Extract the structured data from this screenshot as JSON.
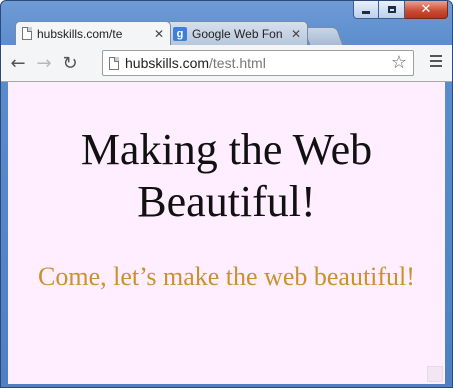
{
  "window": {
    "controls": {
      "minimize": "minimize-icon",
      "maximize": "maximize-icon",
      "close": "close-icon"
    }
  },
  "tabs": [
    {
      "label": "hubskills.com/te",
      "active": true,
      "icon": "page-icon"
    },
    {
      "label": "Google Web Fon",
      "active": false,
      "icon": "google-icon",
      "icon_letter": "g"
    }
  ],
  "tab_close_glyph": "✕",
  "toolbar": {
    "back_glyph": "←",
    "forward_glyph": "→",
    "reload_glyph": "↻",
    "star_glyph": "☆"
  },
  "address_bar": {
    "host": "hubskills.com",
    "path": "/test.html"
  },
  "page": {
    "heading_line1": "Making the Web",
    "heading_line2": "Beautiful!",
    "subtitle": "Come, let’s make the web beautiful!",
    "background_color": "#ffeeff",
    "subtitle_color": "#c9922d"
  }
}
